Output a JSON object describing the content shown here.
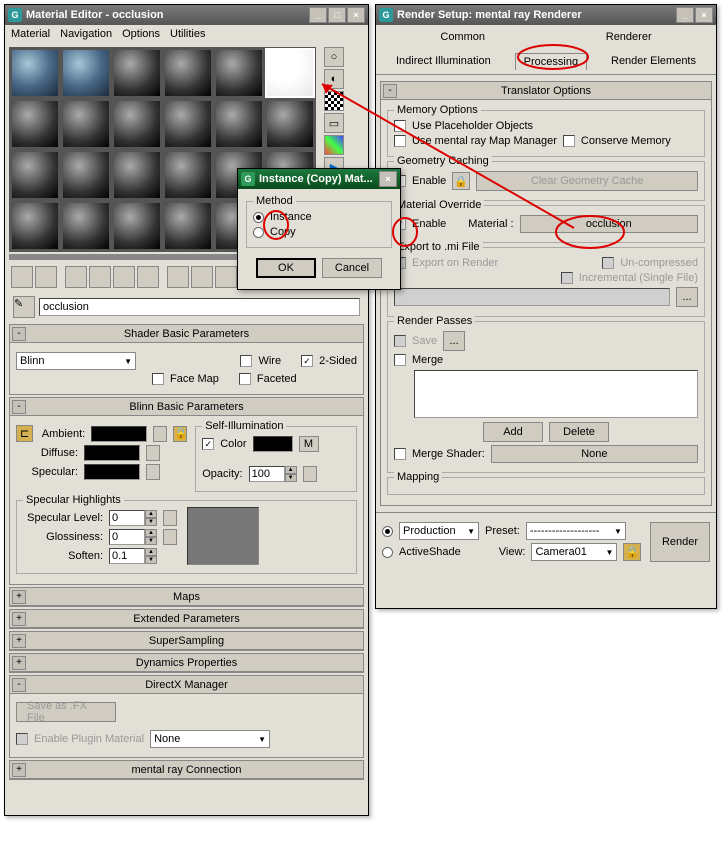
{
  "material_editor": {
    "title": "Material Editor - occlusion",
    "menu": [
      "Material",
      "Navigation",
      "Options",
      "Utilities"
    ],
    "name_field": "occlusion",
    "shader_basic": {
      "title": "Shader Basic Parameters",
      "shader": "Blinn",
      "wire_label": "Wire",
      "two_sided_label": "2-Sided",
      "face_map_label": "Face Map",
      "faceted_label": "Faceted"
    },
    "blinn": {
      "title": "Blinn Basic Parameters",
      "ambient_label": "Ambient:",
      "diffuse_label": "Diffuse:",
      "specular_label": "Specular:",
      "self_illum_label": "Self-Illumination",
      "color_label": "Color",
      "opacity_label": "Opacity:",
      "opacity_val": "100",
      "m_label": "M"
    },
    "highlights": {
      "title": "Specular Highlights",
      "level_label": "Specular Level:",
      "level_val": "0",
      "gloss_label": "Glossiness:",
      "gloss_val": "0",
      "soften_label": "Soften:",
      "soften_val": "0.1"
    },
    "rollouts": {
      "maps": "Maps",
      "extended": "Extended Parameters",
      "supersampling": "SuperSampling",
      "dynamics": "Dynamics Properties",
      "directx": "DirectX Manager",
      "mental": "mental ray Connection"
    },
    "directx": {
      "save_fx": "Save as .FX File",
      "enable_plugin": "Enable Plugin Material",
      "none": "None"
    }
  },
  "render_setup": {
    "title": "Render Setup: mental ray Renderer",
    "tabs": {
      "common": "Common",
      "renderer": "Renderer",
      "indirect": "Indirect Illumination",
      "processing": "Processing",
      "elements": "Render Elements"
    },
    "translator": {
      "title": "Translator Options",
      "memory": "Memory Options",
      "placeholder": "Use Placeholder Objects",
      "map_manager": "Use mental ray Map Manager",
      "conserve": "Conserve Memory",
      "geom_cache": "Geometry Caching",
      "enable": "Enable",
      "clear_cache": "Clear Geometry Cache",
      "mat_override": "Material Override",
      "material_label": "Material :",
      "material_slot": "occlusion",
      "export": "Export to .mi File",
      "export_render": "Export on Render",
      "uncompressed": "Un-compressed",
      "incremental": "Incremental (Single File)"
    },
    "passes": {
      "title": "Render Passes",
      "save": "Save",
      "merge": "Merge",
      "add": "Add",
      "delete": "Delete",
      "merge_shader": "Merge Shader:",
      "none": "None"
    },
    "mapping": {
      "title": "Mapping"
    },
    "bottom": {
      "production": "Production",
      "activeshade": "ActiveShade",
      "preset": "Preset:",
      "preset_val": "-------------------",
      "view": "View:",
      "view_val": "Camera01",
      "render": "Render"
    }
  },
  "dialog": {
    "title": "Instance (Copy) Mat...",
    "method": "Method",
    "instance": "Instance",
    "copy": "Copy",
    "ok": "OK",
    "cancel": "Cancel"
  }
}
